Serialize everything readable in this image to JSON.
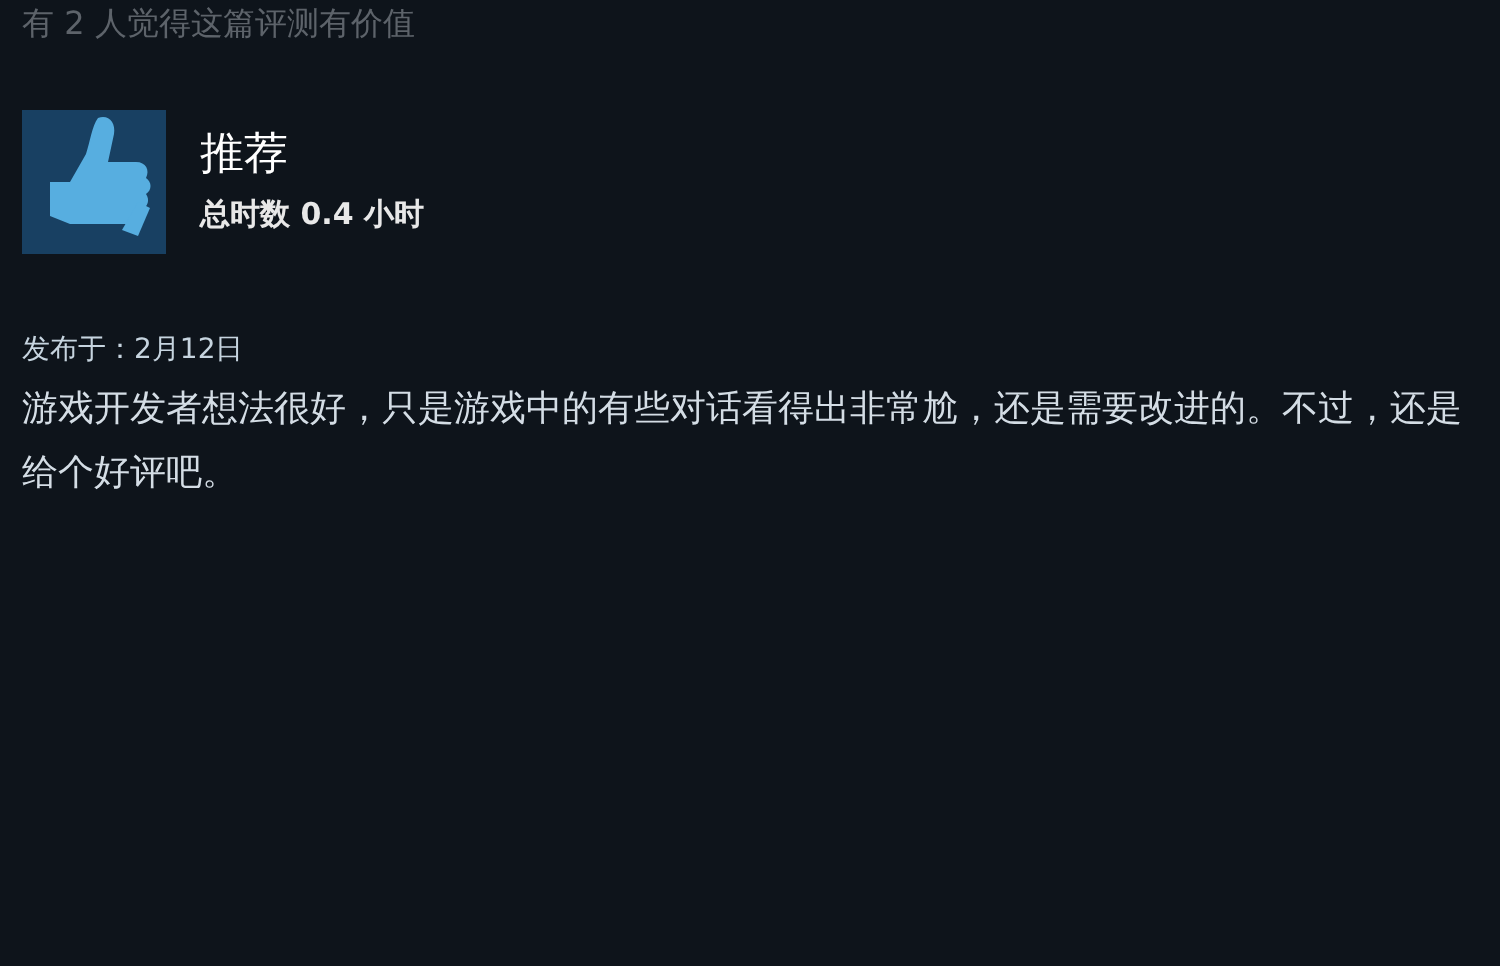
{
  "helpful_note": "有 2 人觉得这篇评测有价值",
  "review": {
    "recommended": true,
    "verdict": "推荐",
    "hours": "总时数 0.4 小时",
    "posted": "发布于：2月12日",
    "body": "游戏开发者想法很好，只是游戏中的有些对话看得出非常尬，还是需要改进的。不过，还是给个好评吧。"
  }
}
